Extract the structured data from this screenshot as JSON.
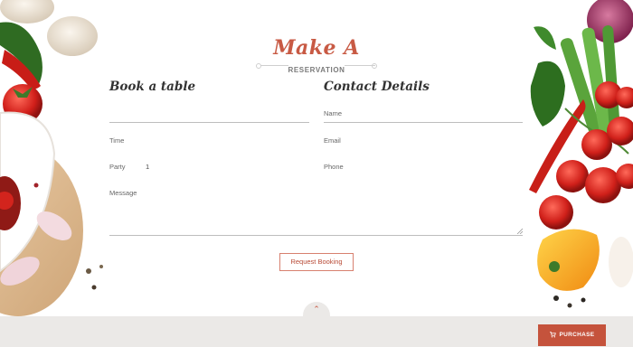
{
  "header": {
    "title": "Make A",
    "subtitle": "RESERVATION"
  },
  "book_table": {
    "heading": "Book a table",
    "time_label": "Time",
    "party_label": "Party",
    "party_value": "1",
    "message_label": "Message"
  },
  "contact": {
    "heading": "Contact Details",
    "name_label": "Name",
    "email_label": "Email",
    "phone_label": "Phone"
  },
  "actions": {
    "request_booking": "Request Booking",
    "purchase": "PURCHASE"
  },
  "icons": {
    "scroll_top": "chevron-up-icon",
    "cart": "cart-icon"
  },
  "colors": {
    "accent": "#c85a44",
    "purchase_bg": "#c5533c",
    "bottom_bar": "#ebe9e7"
  }
}
